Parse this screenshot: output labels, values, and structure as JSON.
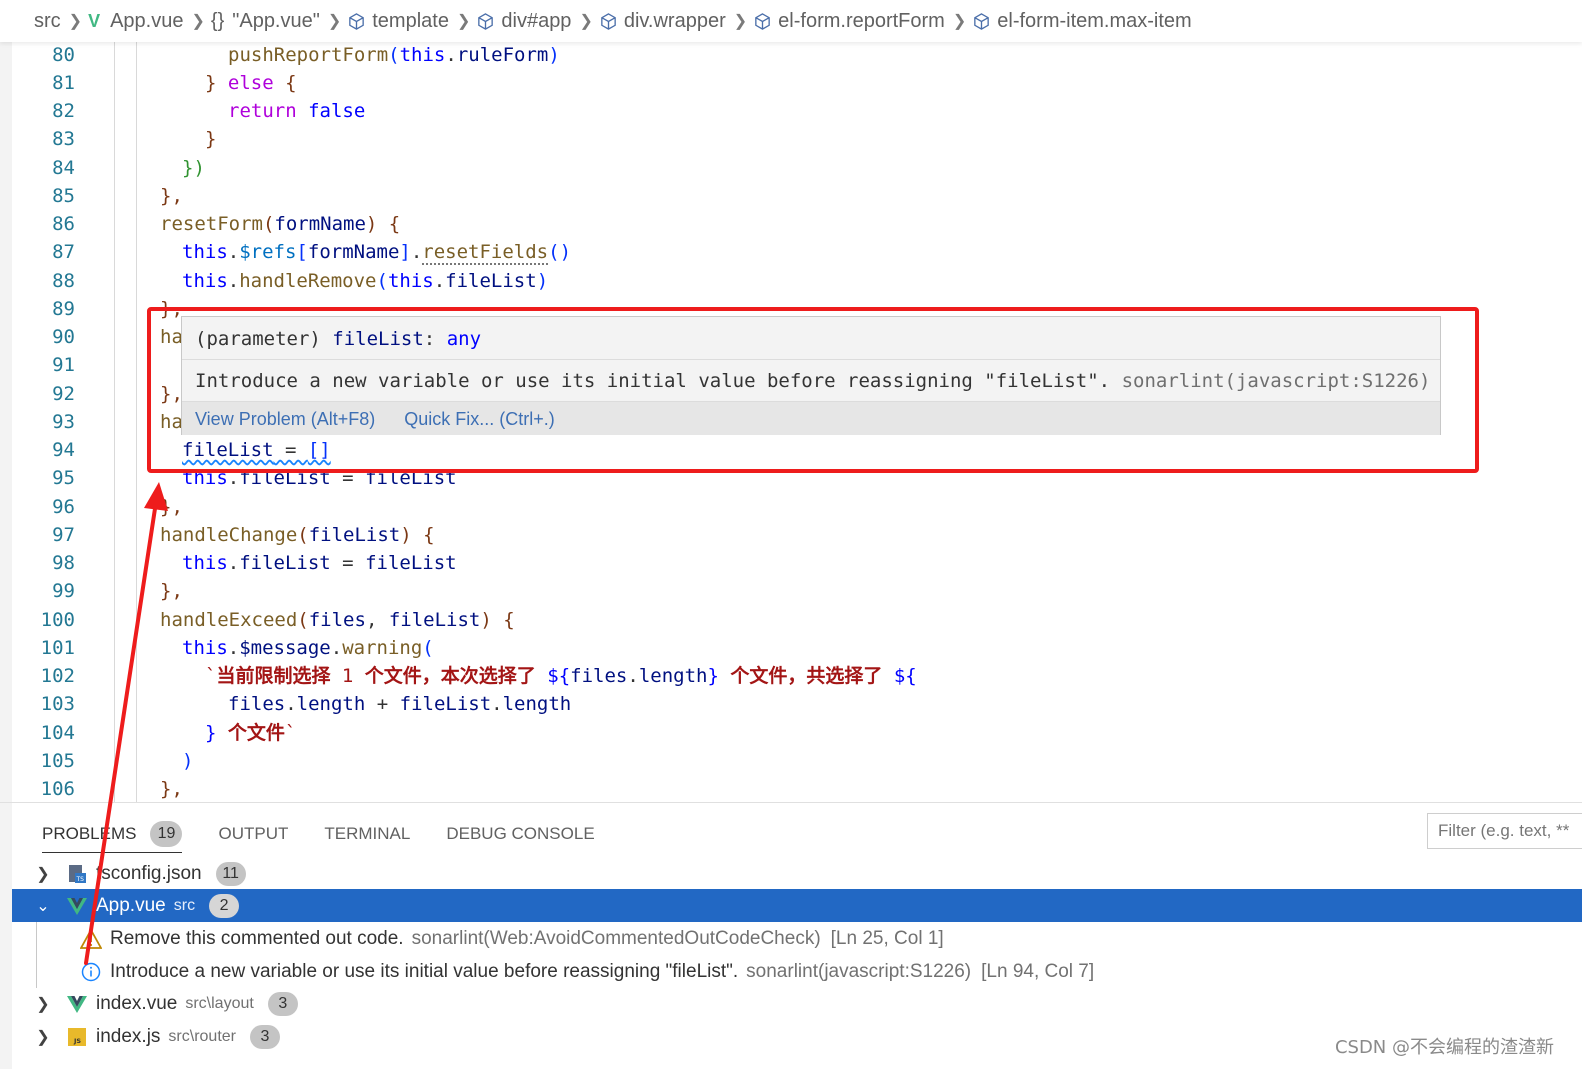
{
  "breadcrumb": {
    "items": [
      "src",
      "App.vue",
      "\"App.vue\"",
      "template",
      "div#app",
      "div.wrapper",
      "el-form.reportForm",
      "el-form-item.max-item"
    ],
    "brace_glyph": "{}"
  },
  "editor": {
    "line_numbers": [
      "80",
      "81",
      "82",
      "83",
      "84",
      "85",
      "86",
      "87",
      "88",
      "89",
      "90",
      "91",
      "92",
      "93",
      "94",
      "95",
      "96",
      "97",
      "98",
      "99",
      "100",
      "101",
      "102",
      "103",
      "104",
      "105",
      "106"
    ],
    "lines": {
      "l80": {
        "fn": "pushReportForm",
        "p1": "(",
        "kw": "this",
        "dot": ".",
        "va": "ruleForm",
        "p2": ")"
      },
      "l81": {
        "a": "} ",
        "kc": "else",
        "b": " {"
      },
      "l82": {
        "kc": "return",
        "sp": " ",
        "kw": "false"
      },
      "l83": {
        "a": "}"
      },
      "l84": {
        "a": "})"
      },
      "l85": {
        "a": "},"
      },
      "l86": {
        "fn": "resetForm",
        "p1": "(",
        "va": "formName",
        "p2": ") {"
      },
      "l87": {
        "kw": "this",
        "dot": ".",
        "va1": "$refs",
        "b1": "[",
        "va2": "formName",
        "b2": "]",
        "dot2": ".",
        "fn": "resetFields",
        "p": "()"
      },
      "l88": {
        "kw": "this",
        "dot": ".",
        "fn": "handleRemove",
        "p1": "(",
        "kw2": "this",
        "dot2": ".",
        "va": "fileList",
        "p2": ")"
      },
      "l89": {
        "a": "},"
      },
      "l90": {
        "a": "ha"
      },
      "l92": {
        "a": "},"
      },
      "l93": {
        "a": "ha"
      },
      "l94": {
        "va": "fileList",
        "eq": " = ",
        "arr": "[]"
      },
      "l95": {
        "kw": "this",
        "dot": ".",
        "va": "fileList",
        "eq": " = ",
        "va2": "fileList"
      },
      "l96": {
        "a": "},"
      },
      "l97": {
        "fn": "handleChange",
        "p1": "(",
        "va": "fileList",
        "p2": ") {"
      },
      "l98": {
        "kw": "this",
        "dot": ".",
        "va": "fileList",
        "eq": " = ",
        "va2": "fileList"
      },
      "l99": {
        "a": "},"
      },
      "l100": {
        "fn": "handleExceed",
        "p1": "(",
        "va": "files",
        "c": ", ",
        "va2": "fileList",
        "p2": ") {"
      },
      "l101": {
        "kw": "this",
        "dot": ".",
        "va": "$message",
        "dot2": ".",
        "fn": "warning",
        "p": "("
      },
      "l102": {
        "bt": "`",
        "t1": "当前限制选择",
        "n": " 1 ",
        "t2": "个文件，本次选择了",
        "sp": " ",
        "ex": "${",
        "va": "files",
        "dot": ".",
        "va2": "length",
        "exe": "}",
        "sp2": " ",
        "t3": "个文件，共选择了",
        "sp3": " ",
        "ex2": "${"
      },
      "l103": {
        "va": "files",
        "dot": ".",
        "va2": "length",
        "op": " + ",
        "va3": "fileList",
        "dot2": ".",
        "va4": "length"
      },
      "l104": {
        "a": "}",
        "sp": " ",
        "t": "个文件",
        "bt": "`"
      },
      "l105": {
        "a": ")"
      },
      "l106": {
        "a": "},"
      }
    }
  },
  "hover": {
    "sig_prefix": "(parameter) ",
    "sig_name": "fileList",
    "sig_colon": ": ",
    "sig_type": "any",
    "message": "Introduce a new variable or use its initial value before reassigning \"fileList\". ",
    "source": "sonarlint(javascript:S1226)",
    "view_problem": "View Problem (Alt+F8)",
    "quick_fix": "Quick Fix... (Ctrl+.)"
  },
  "panel": {
    "tabs": [
      {
        "label": "PROBLEMS",
        "badge": "19"
      },
      {
        "label": "OUTPUT"
      },
      {
        "label": "TERMINAL"
      },
      {
        "label": "DEBUG CONSOLE"
      }
    ],
    "filter_placeholder": "Filter (e.g. text, **",
    "files": [
      {
        "name": "tsconfig.json",
        "path": "",
        "count": "11",
        "expanded": false,
        "icon": "tsconfig-icon"
      },
      {
        "name": "App.vue",
        "path": "src",
        "count": "2",
        "expanded": true,
        "icon": "vue-icon"
      },
      {
        "name": "index.vue",
        "path": "src\\layout",
        "count": "3",
        "expanded": false,
        "icon": "vue-icon"
      },
      {
        "name": "index.js",
        "path": "src\\router",
        "count": "3",
        "expanded": false,
        "icon": "js-icon"
      }
    ],
    "issues": [
      {
        "severity": "warning",
        "message": "Remove this commented out code.",
        "source": "sonarlint(Web:AvoidCommentedOutCodeCheck)",
        "position": "[Ln 25, Col 1]"
      },
      {
        "severity": "info",
        "message": "Introduce a new variable or use its initial value before reassigning \"fileList\".",
        "source": "sonarlint(javascript:S1226)",
        "position": "[Ln 94, Col 7]"
      }
    ]
  },
  "watermark": "CSDN @不会编程的渣渣新",
  "colors": {
    "selection": "#2268c4",
    "annotation": "#ee1c1c",
    "vue": "#41b883",
    "info": "#1a85ff",
    "warning": "#bf8803"
  }
}
